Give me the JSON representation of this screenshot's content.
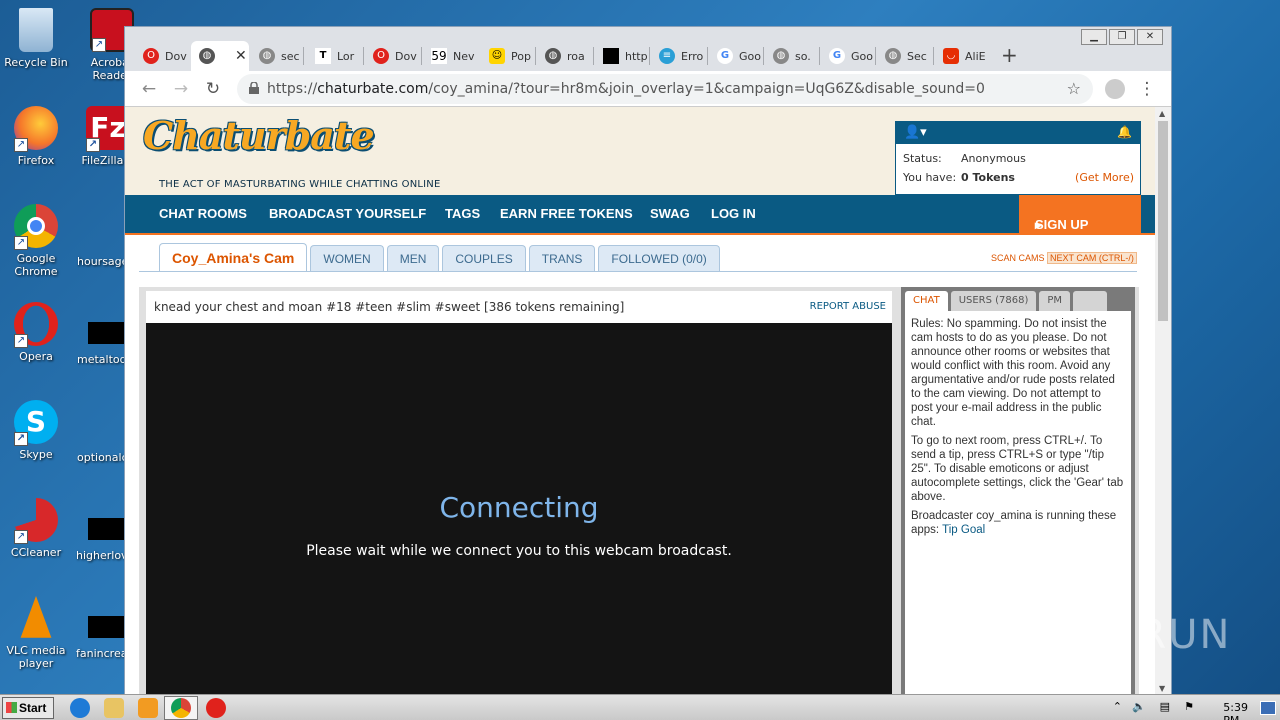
{
  "desktop": {
    "icons": [
      {
        "label": "Recycle Bin",
        "color": "#9cc3e6"
      },
      {
        "label": "Acrobat Reader",
        "color": "#c8101e"
      },
      {
        "label": "Firefox",
        "color": "#f5762a"
      },
      {
        "label": "FileZilla C",
        "color": "#c8101e"
      },
      {
        "label": "Google Chrome",
        "color": "#4285f4"
      },
      {
        "label": "hoursage",
        "color": ""
      },
      {
        "label": "Opera",
        "color": "#e0221c"
      },
      {
        "label": "metaltoda",
        "color": ""
      },
      {
        "label": "Skype",
        "color": "#00aff0"
      },
      {
        "label": "optionalch",
        "color": ""
      },
      {
        "label": "CCleaner",
        "color": "#d8282a"
      },
      {
        "label": "higherlove",
        "color": ""
      },
      {
        "label": "VLC media player",
        "color": "#f28c00"
      },
      {
        "label": "fanincrea",
        "color": ""
      }
    ]
  },
  "browser": {
    "tabs": [
      {
        "label": "Dov",
        "icon": "opera-icon"
      },
      {
        "label": "",
        "icon": "globe-icon",
        "active": true
      },
      {
        "label": "sec",
        "icon": "globe-icon"
      },
      {
        "label": "Lor",
        "icon": "t-icon"
      },
      {
        "label": "Dov",
        "icon": "opera-icon"
      },
      {
        "label": "Nev",
        "icon": "59-icon"
      },
      {
        "label": "Pop",
        "icon": "smiley-icon"
      },
      {
        "label": "roa",
        "icon": "globe-icon"
      },
      {
        "label": "http",
        "icon": "black-square-icon"
      },
      {
        "label": "Erro",
        "icon": "stripe-icon"
      },
      {
        "label": "Goo",
        "icon": "google-icon"
      },
      {
        "label": "so.",
        "icon": "globe-icon"
      },
      {
        "label": "Goo",
        "icon": "google-icon"
      },
      {
        "label": "Sec",
        "icon": "globe-icon"
      },
      {
        "label": "AliE",
        "icon": "aliexpress-icon"
      }
    ],
    "url_prefix": "https://",
    "url_host": "chaturbate.com",
    "url_path": "/coy_amina/?tour=hr8m&join_overlay=1&campaign=UqG6Z&disable_sound=0"
  },
  "site": {
    "logo": "Chaturbate",
    "tagline": "THE ACT OF MASTURBATING WHILE CHATTING ONLINE",
    "status_label": "Status:",
    "status_value": "Anonymous",
    "have_label": "You have:",
    "tokens": "0 Tokens",
    "get_more": "(Get More)",
    "nav": [
      "CHAT ROOMS",
      "BROADCAST YOURSELF",
      "TAGS",
      "EARN FREE TOKENS",
      "SWAG",
      "LOG IN"
    ],
    "signup": "SIGN UP",
    "cam_tabs": [
      "Coy_Amina's Cam",
      "WOMEN",
      "MEN",
      "COUPLES",
      "TRANS",
      "FOLLOWED (0/0)"
    ],
    "scan_cams": "SCAN CAMS",
    "next_cam": "NEXT CAM (CTRL-/)",
    "subject": "knead your chest and moan #18 #teen #slim #sweet [386 tokens remaining]",
    "report_abuse": "REPORT ABUSE",
    "connecting": "Connecting",
    "please_wait": "Please wait while we connect you to this webcam broadcast.",
    "chat_tabs": [
      "CHAT",
      "USERS (7868)",
      "PM",
      ""
    ],
    "rules": "Rules: No spamming. Do not insist the cam hosts to do as you please. Do not announce other rooms or websites that would conflict with this room. Avoid any argumentative and/or rude posts related to the cam viewing. Do not attempt to post your e-mail address in the public chat.",
    "help": "To go to next room, press CTRL+/. To send a tip, press CTRL+S or type \"/tip 25\". To disable emoticons or adjust autocomplete settings, click the 'Gear' tab above.",
    "apps_prefix": "Broadcaster coy_amina is running these apps:",
    "apps_link": "Tip Goal"
  },
  "taskbar": {
    "start": "Start",
    "clock": "5:39 PM"
  },
  "watermark": "ANY RUN"
}
